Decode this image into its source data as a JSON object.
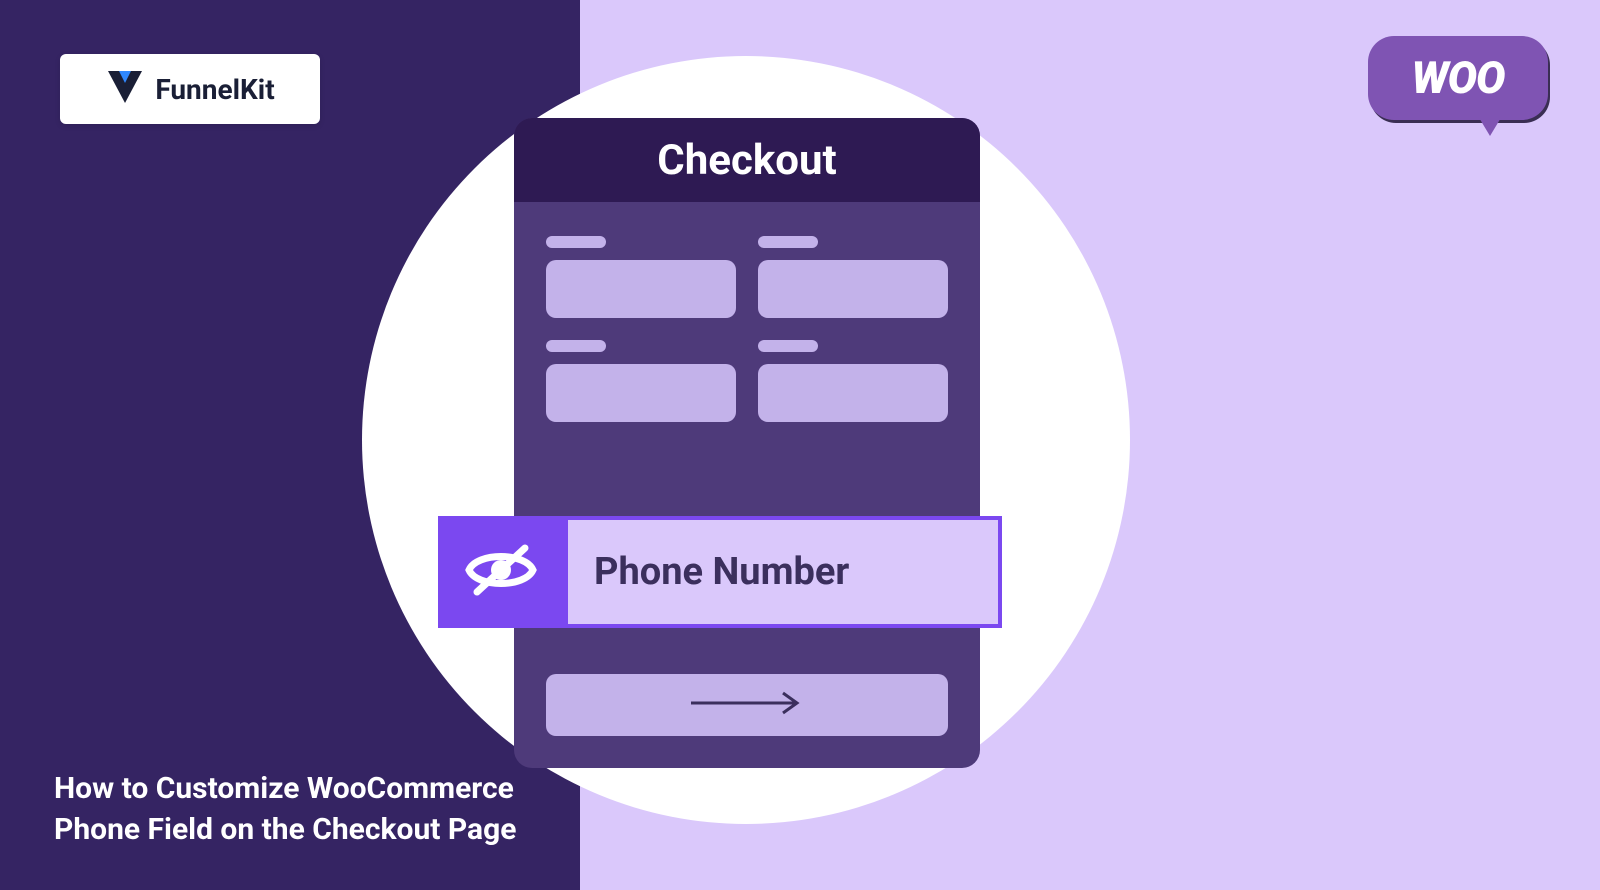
{
  "logo": {
    "brand": "FunnelKit"
  },
  "woo": {
    "text": "WOO"
  },
  "checkout": {
    "title": "Checkout",
    "phoneLabel": "Phone Number"
  },
  "captionLine1": "How to Customize WooCommerce",
  "captionLine2": "Phone Field on the Checkout Page"
}
